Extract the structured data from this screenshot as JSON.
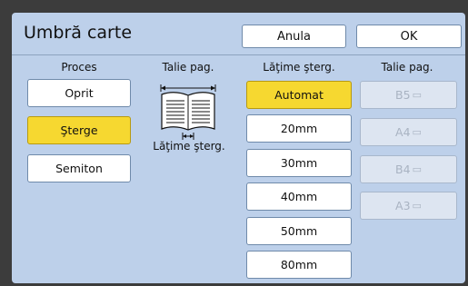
{
  "title": "Umbră carte",
  "buttons": {
    "cancel": "Anula",
    "ok": "OK"
  },
  "process": {
    "header": "Proces",
    "options": [
      "Oprit",
      "Şterge",
      "Semiton"
    ],
    "selected": "Şterge"
  },
  "page_size_illustration": {
    "header": "Talie pag.",
    "caption": "Lăţime şterg."
  },
  "erase_width": {
    "header": "Lăţime şterg.",
    "options": [
      "Automat",
      "20mm",
      "30mm",
      "40mm",
      "50mm",
      "80mm"
    ],
    "selected": "Automat"
  },
  "paper_size": {
    "header": "Talie pag.",
    "options": [
      "B5",
      "A4",
      "B4",
      "A3"
    ],
    "orientation_icon": "portrait-page-icon",
    "state": "disabled"
  },
  "colors": {
    "background": "#bdd0ea",
    "selected": "#f6d830",
    "disabled": "#dde5f1"
  }
}
